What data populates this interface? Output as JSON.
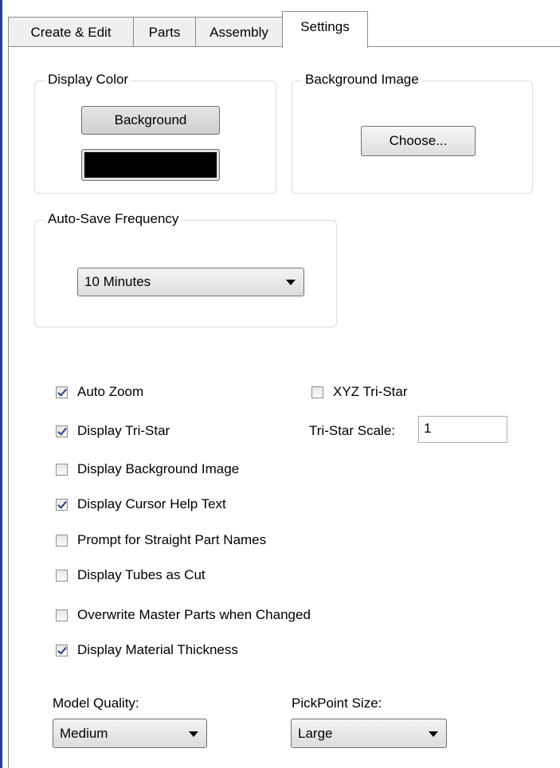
{
  "tabs": [
    "Create & Edit",
    "Parts",
    "Assembly",
    "Settings"
  ],
  "display_color": {
    "title": "Display Color",
    "background_button": "Background",
    "swatch_color": "#000000"
  },
  "background_image": {
    "title": "Background Image",
    "choose_button": "Choose..."
  },
  "auto_save": {
    "title": "Auto-Save Frequency",
    "selected": "10 Minutes"
  },
  "checkboxes": [
    {
      "label": "Auto Zoom",
      "checked": true
    },
    {
      "label": "XYZ Tri-Star",
      "checked": false
    },
    {
      "label": "Display Tri-Star",
      "checked": true
    },
    {
      "label": "Display Background Image",
      "checked": false
    },
    {
      "label": "Display Cursor Help Text",
      "checked": true
    },
    {
      "label": "Prompt for Straight Part Names",
      "checked": false
    },
    {
      "label": "Display Tubes as Cut",
      "checked": false
    },
    {
      "label": "Overwrite Master Parts when Changed",
      "checked": false
    },
    {
      "label": "Display Material Thickness",
      "checked": true
    }
  ],
  "tri_star_scale": {
    "label": "Tri-Star Scale:",
    "value": "1"
  },
  "model_quality": {
    "label": "Model Quality:",
    "selected": "Medium"
  },
  "pickpoint_size": {
    "label": "PickPoint Size:",
    "selected": "Large"
  }
}
